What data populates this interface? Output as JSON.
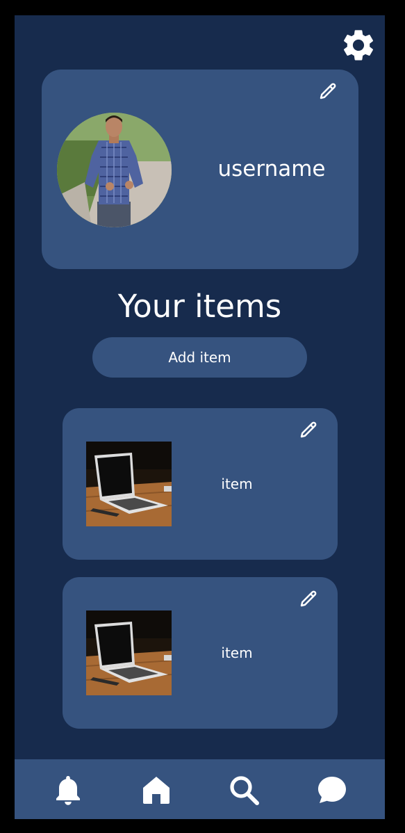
{
  "profile": {
    "username": "username",
    "edit_icon": "pencil-icon",
    "avatar_description": "profile-photo"
  },
  "header": {
    "settings_icon": "gear-icon"
  },
  "items_section": {
    "title": "Your items",
    "add_button_label": "Add item",
    "items": [
      {
        "label": "item",
        "thumbnail": "laptop-photo",
        "edit_icon": "pencil-icon"
      },
      {
        "label": "item",
        "thumbnail": "laptop-photo",
        "edit_icon": "pencil-icon"
      }
    ]
  },
  "bottom_nav": {
    "items": [
      {
        "icon": "bell-icon",
        "label": "notifications"
      },
      {
        "icon": "home-icon",
        "label": "home"
      },
      {
        "icon": "search-icon",
        "label": "search"
      },
      {
        "icon": "chat-icon",
        "label": "messages"
      }
    ]
  },
  "colors": {
    "background": "#172b4d",
    "card": "#36537f",
    "text": "#ffffff",
    "frame": "#000000"
  }
}
